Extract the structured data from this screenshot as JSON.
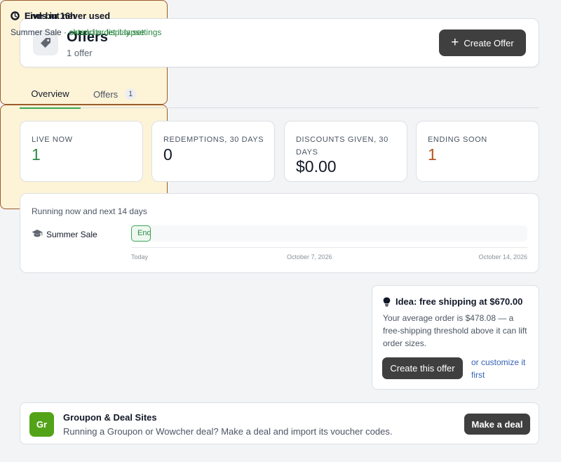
{
  "header": {
    "icon": "tag-icon",
    "title": "Offers",
    "subtitle": "1 offer",
    "create_button_label": "Create Offer"
  },
  "tabs": [
    {
      "label": "Overview",
      "active": true
    },
    {
      "label": "Offers",
      "count": "1",
      "active": false
    }
  ],
  "stats": [
    {
      "label": "LIVE NOW",
      "value": "1",
      "color": "#2e8a46"
    },
    {
      "label": "REDEMPTIONS, 30 DAYS",
      "value": "0",
      "color": "#111827"
    },
    {
      "label": "DISCOUNTS GIVEN, 30 DAYS",
      "value": "$0.00",
      "color": "#111827"
    },
    {
      "label": "ENDING SOON",
      "value": "1",
      "color": "#b4561e"
    }
  ],
  "timeline": {
    "heading": "Running now and next 14 days",
    "rows": [
      {
        "icon": "graduation-cap-icon",
        "name": "Summer Sale",
        "bar_label": "Ends"
      }
    ],
    "ticks": [
      "Today",
      "October 7, 2026",
      "October 14, 2026"
    ]
  },
  "alerts": [
    {
      "icon": "clock-icon",
      "title": "Ends in 16h",
      "offer": "Summer Sale",
      "sep": " · ",
      "link": "extend or let it lapse"
    },
    {
      "icon": "circle-icon",
      "title": "Live but never used",
      "offer": "Summer Sale",
      "sep": " · ",
      "link": "check its display settings"
    }
  ],
  "idea": {
    "icon": "lightbulb-icon",
    "title": "Idea: free shipping at $670.00",
    "body": "Your average order is $478.08 — a free-shipping threshold above it can lift order sizes.",
    "button_label": "Create this offer",
    "link": "or customize it first"
  },
  "deal": {
    "logo": "Gr",
    "title": "Groupon & Deal Sites",
    "text": "Running a Groupon or Wowcher deal? Make a deal and import its voucher codes.",
    "button_label": "Make a deal"
  },
  "colors": {
    "accent_green": "#3aa757",
    "warning_orange": "#b4561e",
    "alert_bg": "#fdf3d7",
    "button_dark": "#3f3f3f",
    "link_blue": "#3563b5"
  }
}
